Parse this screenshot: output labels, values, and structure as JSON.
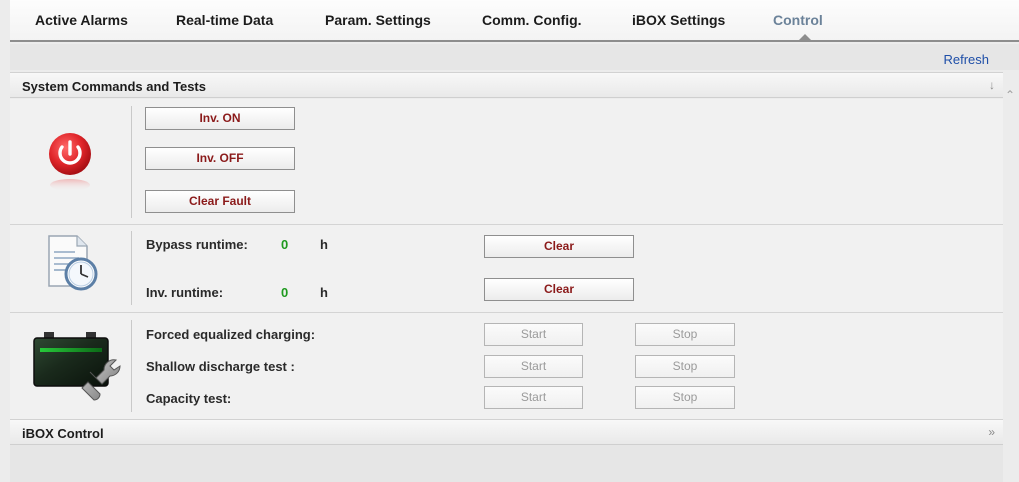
{
  "nav": {
    "tabs": [
      {
        "label": "Active Alarms"
      },
      {
        "label": "Real-time Data"
      },
      {
        "label": "Param. Settings"
      },
      {
        "label": "Comm. Config."
      },
      {
        "label": "iBOX Settings"
      },
      {
        "label": "Control"
      }
    ],
    "active_tab": "Control"
  },
  "toolbar": {
    "refresh_label": "Refresh"
  },
  "system_commands": {
    "title": "System Commands and Tests",
    "collapse_icon": "double-chevron-down-icon",
    "power": {
      "icon": "power-icon",
      "buttons": {
        "inv_on": "Inv. ON",
        "inv_off": "Inv. OFF",
        "clear_fault": "Clear Fault"
      }
    },
    "runtime": {
      "icon": "document-clock-icon",
      "rows": [
        {
          "label": "Bypass runtime:",
          "value": "0",
          "unit": "h",
          "button": "Clear"
        },
        {
          "label": "Inv. runtime:",
          "value": "0",
          "unit": "h",
          "button": "Clear"
        }
      ]
    },
    "battery": {
      "icon": "battery-wrench-icon",
      "rows": [
        {
          "label": "Forced equalized charging:",
          "start": "Start",
          "stop": "Stop"
        },
        {
          "label": "Shallow discharge test :",
          "start": "Start",
          "stop": "Stop"
        },
        {
          "label": "Capacity test:",
          "start": "Start",
          "stop": "Stop"
        }
      ]
    }
  },
  "ibox_control": {
    "title": "iBOX Control",
    "expand_icon": "double-chevron-right-icon"
  },
  "colors": {
    "accent_tab": "#6b8299",
    "button_text": "#8b1a1a",
    "value_green": "#1f9a1f",
    "link_blue": "#1f4fa8"
  }
}
